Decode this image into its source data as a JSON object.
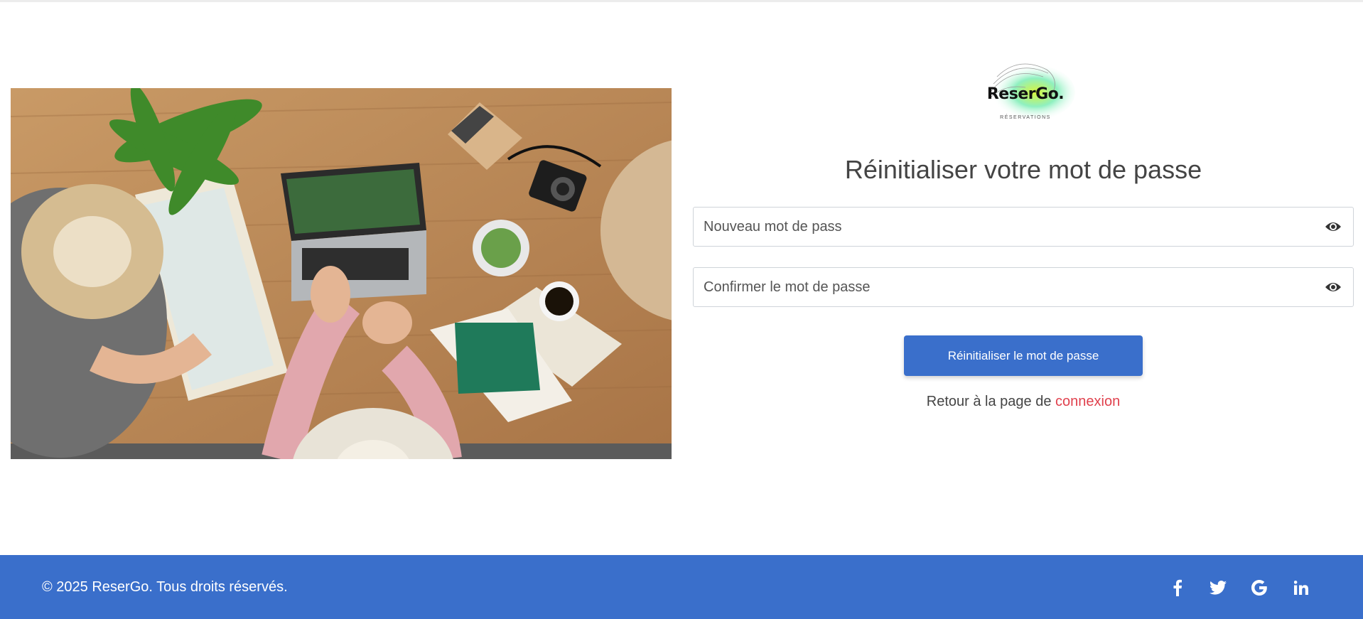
{
  "logo": {
    "name": "ReserGo.",
    "tagline": "RÉSERVATIONS"
  },
  "form": {
    "title": "Réinitialiser votre mot de passe",
    "new_password": {
      "placeholder": "Nouveau mot de pass",
      "value": "",
      "icon": "eye-icon"
    },
    "confirm_password": {
      "placeholder": "Confirmer le mot de passe",
      "value": "",
      "icon": "eye-icon"
    },
    "submit_label": "Réinitialiser le mot de passe",
    "back_text": "Retour à la page de ",
    "back_link": "connexion"
  },
  "footer": {
    "copyright": "© 2025 ReserGo. Tous droits réservés.",
    "social": [
      "facebook-icon",
      "twitter-icon",
      "google-icon",
      "linkedin-icon"
    ]
  },
  "colors": {
    "primary": "#3a6fcb",
    "link": "#e0414d",
    "title": "#444444"
  }
}
